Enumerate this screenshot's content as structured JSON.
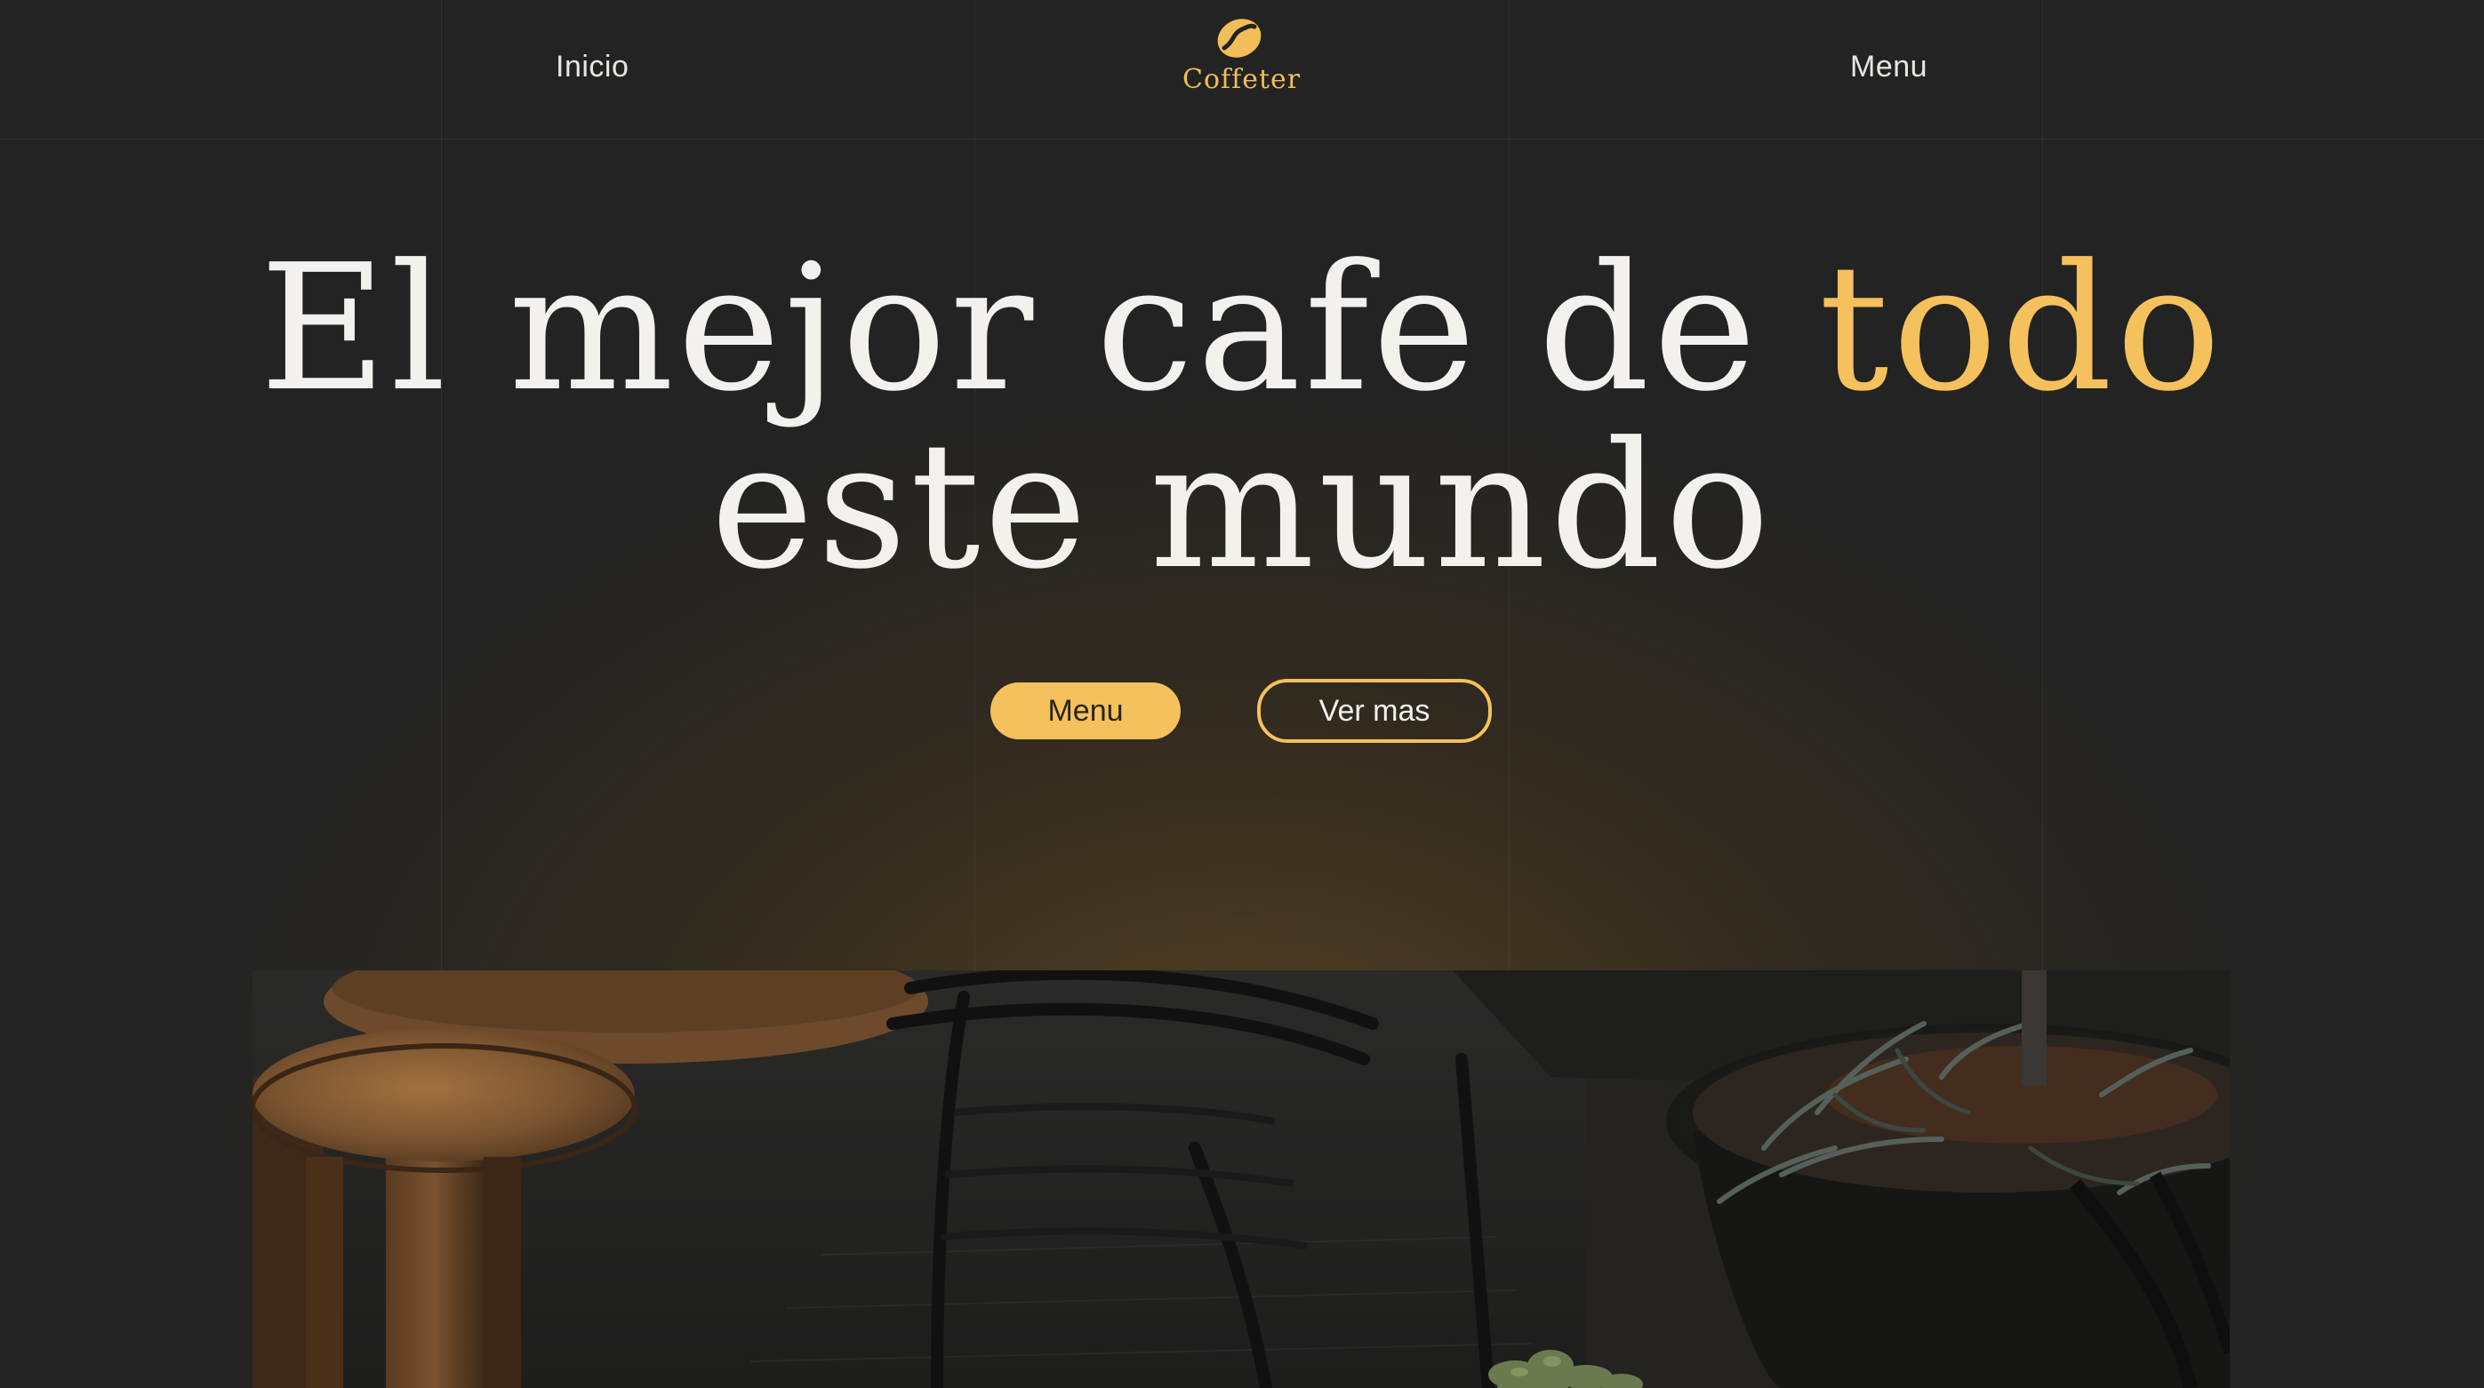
{
  "header": {
    "nav_home": "Inicio",
    "nav_menu": "Menu",
    "logo_text": "Coffeter",
    "logo_icon": "coffee-bean-icon"
  },
  "hero": {
    "title_line1": "El mejor cafe de",
    "title_accent": "todo",
    "title_line2": "este mundo",
    "primary_button": "Menu",
    "secondary_button": "Ver mas"
  },
  "colors": {
    "background": "#232323",
    "accent": "#f5c15c",
    "text": "#f3f1ee"
  }
}
